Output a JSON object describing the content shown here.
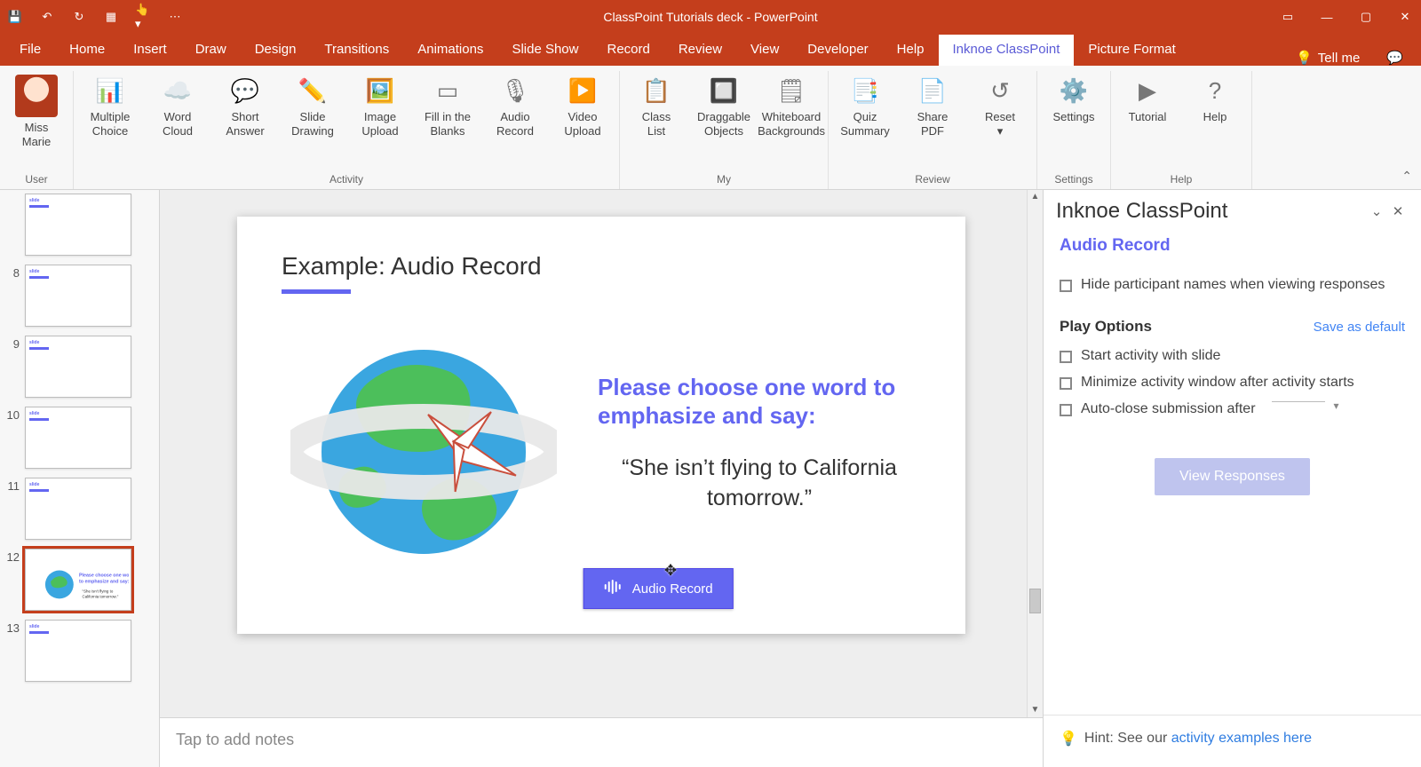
{
  "titlebar": {
    "title": "ClassPoint Tutorials deck  -  PowerPoint"
  },
  "ribbon_tabs": [
    "File",
    "Home",
    "Insert",
    "Draw",
    "Design",
    "Transitions",
    "Animations",
    "Slide Show",
    "Record",
    "Review",
    "View",
    "Developer",
    "Help",
    "Inknoe ClassPoint",
    "Picture Format"
  ],
  "active_tab": "Inknoe ClassPoint",
  "tellme": "Tell me",
  "ribbon": {
    "groups": [
      {
        "label": "User",
        "buttons": [
          {
            "name": "user-avatar",
            "text": "Miss\nMarie",
            "icon": "avatar"
          }
        ]
      },
      {
        "label": "Activity",
        "buttons": [
          {
            "name": "multiple-choice",
            "text": "Multiple\nChoice",
            "icon": "📊"
          },
          {
            "name": "word-cloud",
            "text": "Word\nCloud",
            "icon": "☁️"
          },
          {
            "name": "short-answer",
            "text": "Short\nAnswer",
            "icon": "💬"
          },
          {
            "name": "slide-drawing",
            "text": "Slide\nDrawing",
            "icon": "✏️"
          },
          {
            "name": "image-upload",
            "text": "Image\nUpload",
            "icon": "🖼️"
          },
          {
            "name": "fill-blanks",
            "text": "Fill in the\nBlanks",
            "icon": "▭"
          },
          {
            "name": "audio-record",
            "text": "Audio\nRecord",
            "icon": "🎙"
          },
          {
            "name": "video-upload",
            "text": "Video\nUpload",
            "icon": "▶️"
          }
        ]
      },
      {
        "label": "My",
        "buttons": [
          {
            "name": "class-list",
            "text": "Class\nList",
            "icon": "📋"
          },
          {
            "name": "draggable-objects",
            "text": "Draggable\nObjects",
            "icon": "🔲"
          },
          {
            "name": "whiteboard-bg",
            "text": "Whiteboard\nBackgrounds",
            "icon": "🗒"
          }
        ]
      },
      {
        "label": "Review",
        "buttons": [
          {
            "name": "quiz-summary",
            "text": "Quiz\nSummary",
            "icon": "📑"
          },
          {
            "name": "share-pdf",
            "text": "Share\nPDF",
            "icon": "📄"
          },
          {
            "name": "reset",
            "text": "Reset\n▾",
            "icon": "↺"
          }
        ]
      },
      {
        "label": "Settings",
        "buttons": [
          {
            "name": "settings",
            "text": "Settings",
            "icon": "⚙️"
          }
        ]
      },
      {
        "label": "Help",
        "buttons": [
          {
            "name": "tutorial",
            "text": "Tutorial",
            "icon": "▶"
          },
          {
            "name": "help",
            "text": "Help",
            "icon": "?"
          }
        ]
      }
    ]
  },
  "thumbs": [
    {
      "num": "",
      "sel": false
    },
    {
      "num": "8",
      "sel": false
    },
    {
      "num": "9",
      "sel": false
    },
    {
      "num": "10",
      "sel": false
    },
    {
      "num": "11",
      "sel": false
    },
    {
      "num": "12",
      "sel": true
    },
    {
      "num": "13",
      "sel": false
    }
  ],
  "slide": {
    "title": "Example: Audio Record",
    "prompt": "Please choose one word to emphasize and say:",
    "quote": "“She isn’t flying to California tomorrow.”",
    "button_label": "Audio Record"
  },
  "notes_placeholder": "Tap to add notes",
  "pane": {
    "title": "Inknoe ClassPoint",
    "subtitle": "Audio Record",
    "opt_hide_names": "Hide participant names when viewing responses",
    "play_options": "Play Options",
    "save_default": "Save as default",
    "opt_start_with_slide": "Start activity with slide",
    "opt_minimize": "Minimize activity window after activity starts",
    "opt_autoclose": "Auto-close submission after",
    "view_responses": "View Responses",
    "hint_prefix": "Hint: See our ",
    "hint_link": "activity examples here"
  }
}
